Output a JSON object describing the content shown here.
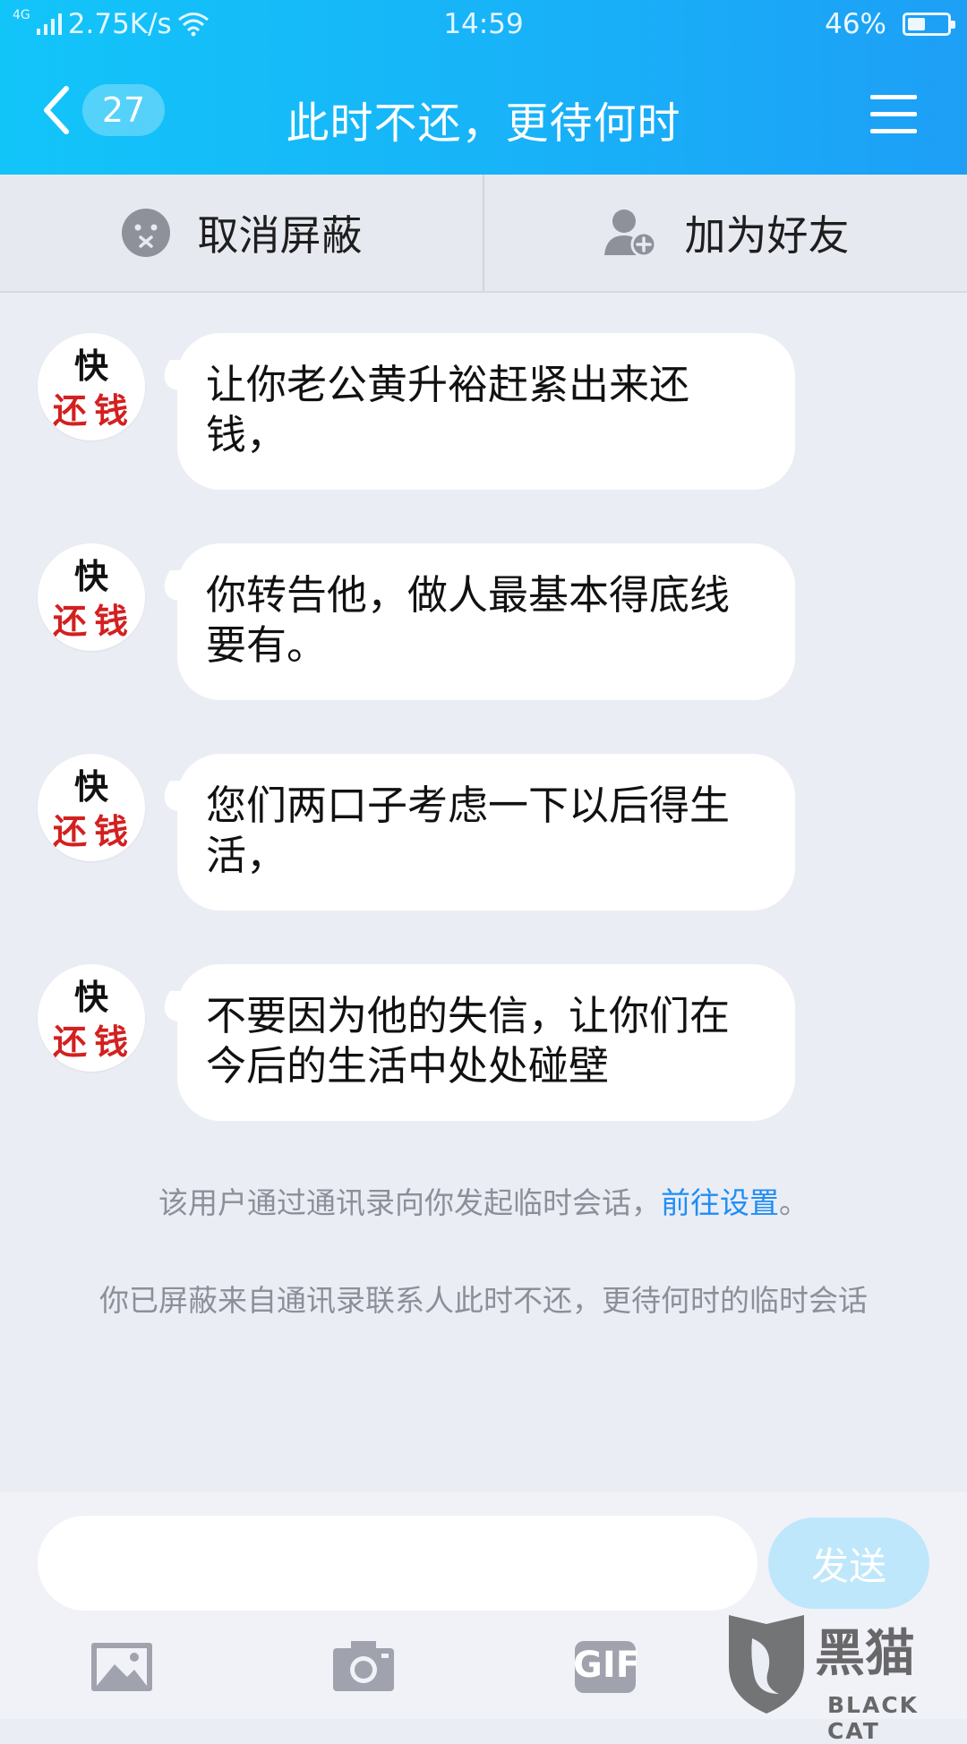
{
  "status_bar": {
    "network_type": "4G",
    "speed": "2.75K/s",
    "time": "14:59",
    "battery_percent": "46%",
    "battery_level": 0.46
  },
  "title_bar": {
    "unread_count": "27",
    "title": "此时不还，更待何时",
    "icons": {
      "back": "chevron-left-icon",
      "menu": "hamburger-menu-icon"
    }
  },
  "actions": {
    "unblock_label": "取消屏蔽",
    "add_friend_label": "加为好友",
    "icons": {
      "unblock": "blocked-face-icon",
      "add_friend": "add-friend-icon"
    }
  },
  "avatar": {
    "line1": "快",
    "line2": "还钱"
  },
  "messages": [
    {
      "text": "让你老公黄升裕赶紧出来还钱，"
    },
    {
      "text": "你转告他，做人最基本得底线要有。"
    },
    {
      "text": "您们两口子考虑一下以后得生活，"
    },
    {
      "text": "不要因为他的失信，让你们在今后的生活中处处碰壁"
    }
  ],
  "notices": {
    "temp_session_text": "该用户通过通讯录向你发起临时会话，",
    "temp_session_link": "前往设置",
    "temp_session_end": "。",
    "blocked_text": "你已屏蔽来自通讯录联系人此时不还，更待何时的临时会话"
  },
  "input": {
    "value": "",
    "send_label": "发送"
  },
  "toolbar": {
    "gif_label": "GIF",
    "icons": [
      "image-icon",
      "camera-icon",
      "gif-icon"
    ]
  },
  "watermark": {
    "cn": "黑猫",
    "en": "BLACK CAT"
  },
  "colors": {
    "header_start": "#12c5f9",
    "header_end": "#1d9ff6",
    "link": "#1f8ef5",
    "send_disabled": "#bfe7fb",
    "avatar_red": "#d32020"
  }
}
